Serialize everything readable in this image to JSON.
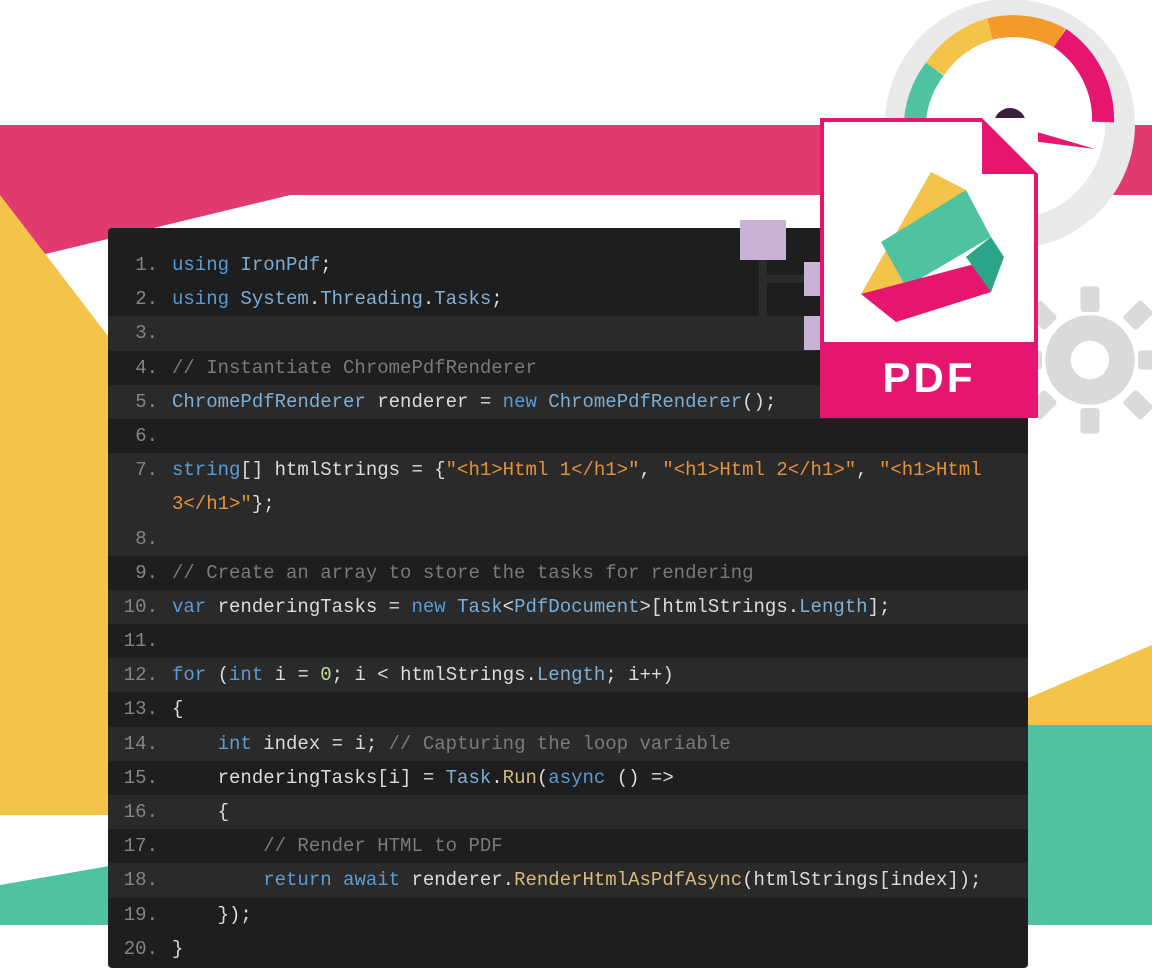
{
  "pdf_label": "PDF",
  "code": {
    "lines": [
      {
        "n": 1,
        "hl": false,
        "tokens": [
          [
            "c-kw1",
            "using"
          ],
          [
            "",
            ": "
          ],
          [
            "c-type",
            "IronPdf"
          ],
          [
            "",
            ";"
          ]
        ]
      },
      {
        "n": 2,
        "hl": false,
        "tokens": [
          [
            "c-kw1",
            "using"
          ],
          [
            "",
            " "
          ],
          [
            "c-type",
            "System"
          ],
          [
            "",
            "."
          ],
          [
            "c-member",
            "Threading"
          ],
          [
            "",
            "."
          ],
          [
            "c-member",
            "Tasks"
          ],
          [
            "",
            ";"
          ]
        ]
      },
      {
        "n": 3,
        "hl": true,
        "tokens": [
          [
            "",
            ""
          ]
        ]
      },
      {
        "n": 4,
        "hl": false,
        "tokens": [
          [
            "c-comment",
            "// Instantiate ChromePdfRenderer"
          ]
        ]
      },
      {
        "n": 5,
        "hl": true,
        "tokens": [
          [
            "c-type",
            "ChromePdfRenderer"
          ],
          [
            "",
            " renderer = "
          ],
          [
            "c-kw1",
            "new"
          ],
          [
            "",
            " "
          ],
          [
            "c-type",
            "ChromePdfRenderer"
          ],
          [
            "",
            "();"
          ]
        ]
      },
      {
        "n": 6,
        "hl": false,
        "tokens": [
          [
            "",
            ""
          ]
        ]
      },
      {
        "n": 7,
        "hl": true,
        "tokens": [
          [
            "c-kw1",
            "string"
          ],
          [
            "",
            "[] htmlStrings = {"
          ],
          [
            "c-string",
            "\"<h1>Html 1</h1>\""
          ],
          [
            "",
            ", "
          ],
          [
            "c-string",
            "\"<h1>Html 2</h1>\""
          ],
          [
            "",
            ", "
          ],
          [
            "c-string",
            "\"<h1>Html 3</h1>\""
          ],
          [
            "",
            "}; "
          ]
        ]
      },
      {
        "n": 8,
        "hl": true,
        "tokens": [
          [
            "",
            ""
          ]
        ]
      },
      {
        "n": 9,
        "hl": false,
        "tokens": [
          [
            "c-comment",
            "// Create an array to store the tasks for rendering"
          ]
        ]
      },
      {
        "n": 10,
        "hl": true,
        "tokens": [
          [
            "c-kw1",
            "var"
          ],
          [
            "",
            " renderingTasks = "
          ],
          [
            "c-kw1",
            "new"
          ],
          [
            "",
            " "
          ],
          [
            "c-type",
            "Task"
          ],
          [
            "",
            "<"
          ],
          [
            "c-type",
            "PdfDocument"
          ],
          [
            "",
            ">[htmlStrings."
          ],
          [
            "c-member",
            "Length"
          ],
          [
            "",
            "]; "
          ]
        ]
      },
      {
        "n": 11,
        "hl": false,
        "tokens": [
          [
            "",
            ""
          ]
        ]
      },
      {
        "n": 12,
        "hl": true,
        "tokens": [
          [
            "c-kw1",
            "for"
          ],
          [
            "",
            " ("
          ],
          [
            "c-kw1",
            "int"
          ],
          [
            "",
            " i = "
          ],
          [
            "c-num",
            "0"
          ],
          [
            "",
            "; i < htmlStrings."
          ],
          [
            "c-member",
            "Length"
          ],
          [
            "",
            "; i++)"
          ]
        ]
      },
      {
        "n": 13,
        "hl": false,
        "tokens": [
          [
            "",
            "{"
          ]
        ]
      },
      {
        "n": 14,
        "hl": true,
        "tokens": [
          [
            "",
            "    "
          ],
          [
            "c-kw1",
            "int"
          ],
          [
            "",
            " index = i; "
          ],
          [
            "c-comment",
            "// Capturing the loop variable"
          ]
        ]
      },
      {
        "n": 15,
        "hl": false,
        "tokens": [
          [
            "",
            "    renderingTasks[i] = "
          ],
          [
            "c-type",
            "Task"
          ],
          [
            "",
            "."
          ],
          [
            "c-method",
            "Run"
          ],
          [
            "",
            "("
          ],
          [
            "c-kw1",
            "async"
          ],
          [
            "",
            " () =>"
          ]
        ]
      },
      {
        "n": 16,
        "hl": true,
        "tokens": [
          [
            "",
            "    {"
          ]
        ]
      },
      {
        "n": 17,
        "hl": false,
        "tokens": [
          [
            "",
            "        "
          ],
          [
            "c-comment",
            "// Render HTML to PDF"
          ]
        ]
      },
      {
        "n": 18,
        "hl": true,
        "tokens": [
          [
            "",
            "        "
          ],
          [
            "c-kw1",
            "return"
          ],
          [
            "",
            " "
          ],
          [
            "c-kw1",
            "await"
          ],
          [
            "",
            " renderer."
          ],
          [
            "c-method",
            "RenderHtmlAsPdfAsync"
          ],
          [
            "",
            "(htmlStrings[index]);"
          ]
        ]
      },
      {
        "n": 19,
        "hl": false,
        "tokens": [
          [
            "",
            "    });"
          ]
        ]
      },
      {
        "n": 20,
        "hl": false,
        "tokens": [
          [
            "",
            "}"
          ]
        ]
      }
    ]
  }
}
